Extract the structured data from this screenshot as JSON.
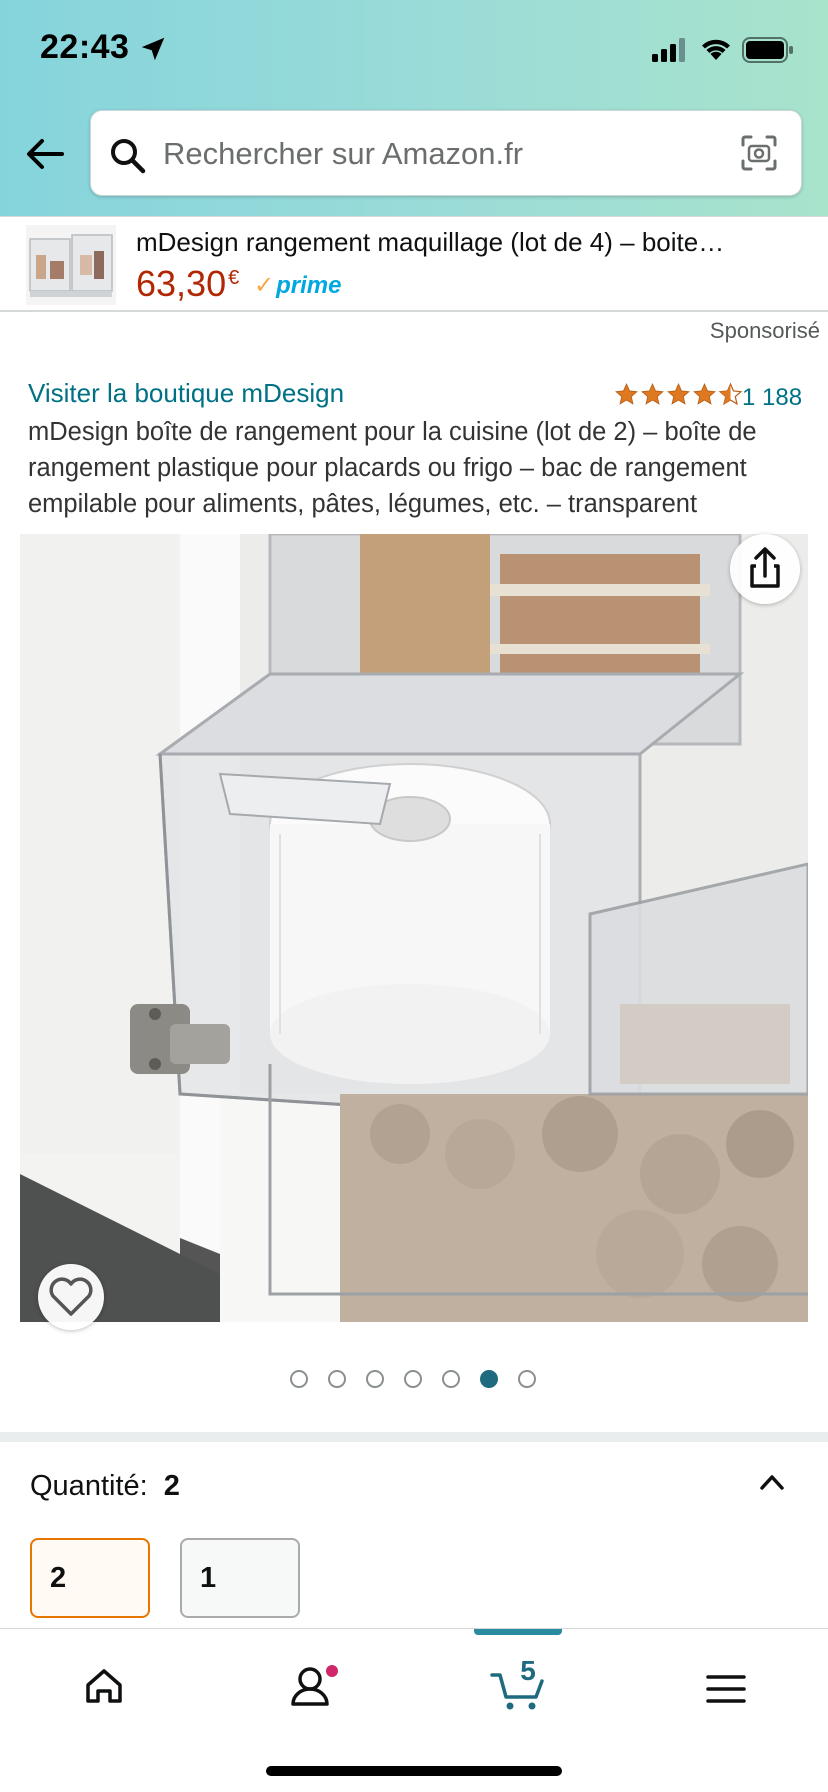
{
  "status_bar": {
    "time": "22:43"
  },
  "search": {
    "placeholder": "Rechercher sur Amazon.fr"
  },
  "sponsored_product": {
    "title": "mDesign rangement maquillage (lot de 4) – boite…",
    "price": "63,30",
    "currency": "€",
    "prime_label": "prime",
    "sponsored_label": "Sponsorisé"
  },
  "product": {
    "store_link": "Visiter la boutique mDesign",
    "rating": 4.5,
    "rating_count": "1 188",
    "title": "mDesign boîte de rangement pour la cuisine (lot de 2) – boîte de rangement plastique pour placards ou frigo – bac de rangement empilable pour aliments, pâtes, légumes, etc. – transparent"
  },
  "carousel": {
    "total": 7,
    "active_index": 5
  },
  "quantity": {
    "label": "Quantité:",
    "value": "2",
    "options": [
      "2",
      "1"
    ]
  },
  "bottom_nav": {
    "cart_count": "5"
  },
  "colors": {
    "accent": "#007185",
    "price": "#b12704",
    "selected_border": "#e77600",
    "star": "#de7921"
  }
}
